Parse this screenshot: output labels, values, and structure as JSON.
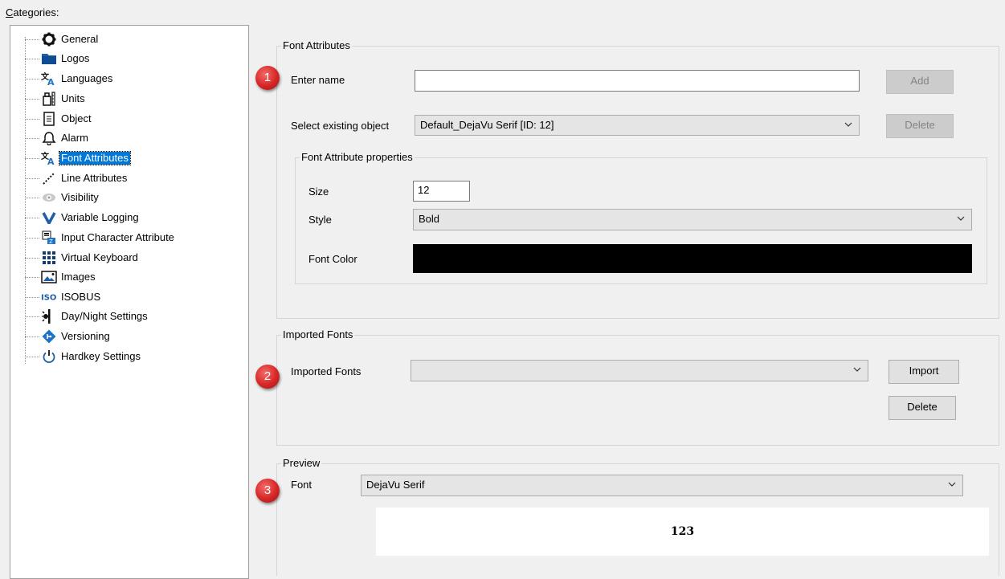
{
  "categories_label_prefix": "C",
  "categories_label_rest": "ategories:",
  "tree": {
    "items": [
      {
        "label": "General",
        "icon": "gear-icon"
      },
      {
        "label": "Logos",
        "icon": "folder-icon"
      },
      {
        "label": "Languages",
        "icon": "languages-icon"
      },
      {
        "label": "Units",
        "icon": "units-icon"
      },
      {
        "label": "Object",
        "icon": "document-icon"
      },
      {
        "label": "Alarm",
        "icon": "bell-icon"
      },
      {
        "label": "Font Attributes",
        "icon": "font-icon"
      },
      {
        "label": "Line Attributes",
        "icon": "line-icon"
      },
      {
        "label": "Visibility",
        "icon": "eye-icon"
      },
      {
        "label": "Variable Logging",
        "icon": "v-icon"
      },
      {
        "label": "Input Character Attribute",
        "icon": "input-character-icon"
      },
      {
        "label": "Virtual Keyboard",
        "icon": "keyboard-icon"
      },
      {
        "label": "Images",
        "icon": "image-icon"
      },
      {
        "label": "ISOBUS",
        "icon": "iso-icon"
      },
      {
        "label": "Day/Night Settings",
        "icon": "day-night-icon"
      },
      {
        "label": "Versioning",
        "icon": "versioning-icon"
      },
      {
        "label": "Hardkey Settings",
        "icon": "power-icon"
      }
    ],
    "selected": "Font Attributes"
  },
  "font_attributes": {
    "title": "Font Attributes",
    "enter_name_label": "Enter name",
    "enter_name_value": "",
    "add_label": "Add",
    "select_existing_label": "Select existing object",
    "select_existing_value": "Default_DejaVu Serif [ID: 12]",
    "delete_label": "Delete",
    "properties": {
      "title": "Font Attribute properties",
      "size_label": "Size",
      "size_value": "12",
      "style_label": "Style",
      "style_value": "Bold",
      "font_color_label": "Font Color",
      "font_color_value": "#000000"
    }
  },
  "imported_fonts": {
    "title": "Imported Fonts",
    "label": "Imported Fonts",
    "value": "",
    "import_label": "Import",
    "delete_label": "Delete"
  },
  "preview": {
    "title": "Preview",
    "font_label": "Font",
    "font_value": "DejaVu Serif",
    "sample_text": "123"
  },
  "badges": [
    "1",
    "2",
    "3"
  ],
  "colors": {
    "selection": "#0078d7",
    "badge": "#d62626",
    "window_bg": "#f0f0f0"
  }
}
